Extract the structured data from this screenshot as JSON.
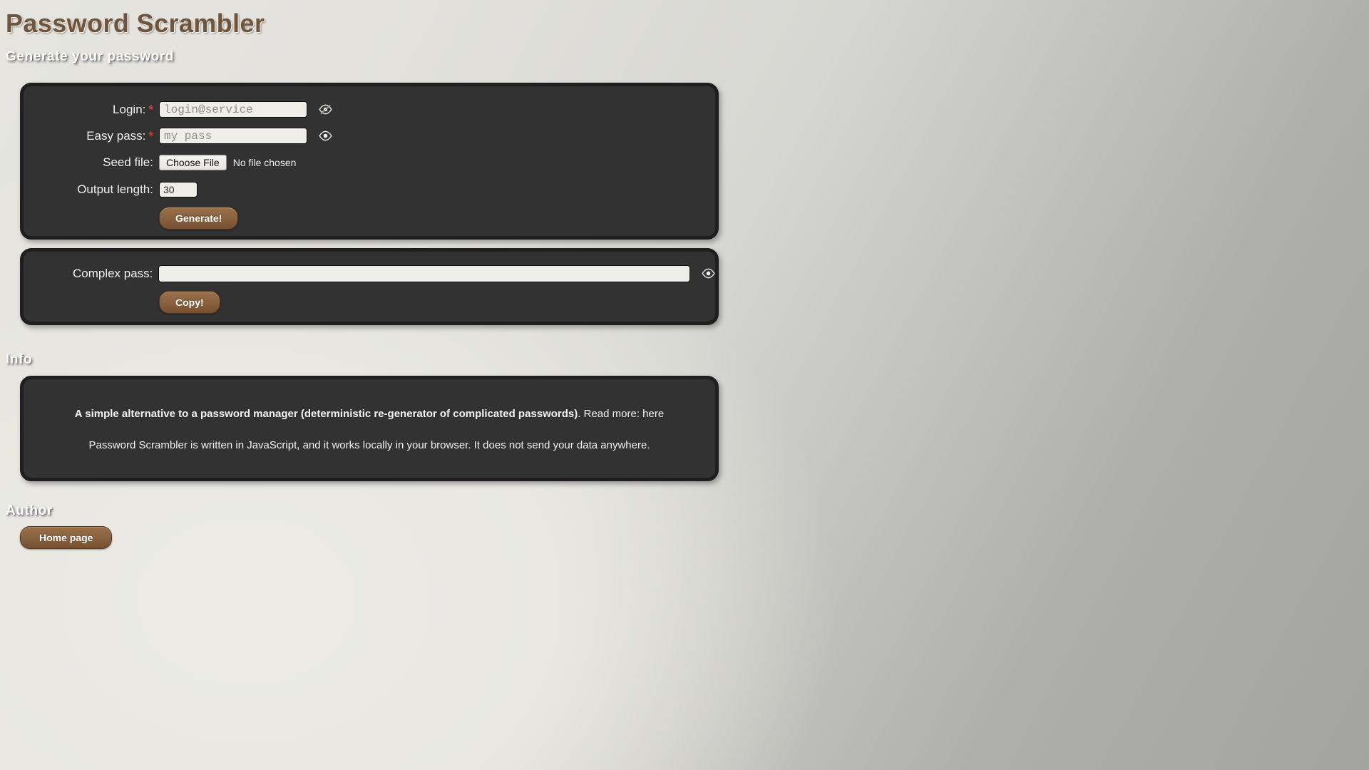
{
  "app": {
    "title": "Password Scrambler"
  },
  "generate_section": {
    "heading": "Generate your password",
    "fields": {
      "login": {
        "label": "Login:",
        "required_marker": "*",
        "value": "",
        "placeholder": "login@service",
        "toggle_icon": "eye-slash-icon"
      },
      "easy_pass": {
        "label": "Easy pass:",
        "required_marker": "*",
        "value": "",
        "placeholder": "my pass",
        "toggle_icon": "eye-icon"
      },
      "seed_file": {
        "label": "Seed file:",
        "button_label": "Choose File",
        "status": "No file chosen"
      },
      "output_length": {
        "label": "Output length:",
        "value": "30"
      }
    },
    "generate_button": "Generate!"
  },
  "result_section": {
    "complex_pass": {
      "label": "Complex pass:",
      "value": "",
      "placeholder": "",
      "toggle_icon": "eye-icon"
    },
    "copy_button": "Copy!"
  },
  "info_section": {
    "heading": "Info",
    "line1_bold": "A simple alternative to a password manager (deterministic re-generator of complicated passwords)",
    "line1_rest": ". Read more: ",
    "line1_link": "here",
    "line2": "Password Scrambler is written in JavaScript, and it works locally in your browser. It does not send your data anywhere."
  },
  "author_section": {
    "heading": "Author",
    "home_button": "Home page"
  },
  "colors": {
    "title_brown": "#6f553c",
    "button_brown": "#8a6340",
    "panel_bg": "#323232",
    "panel_border": "#1f1f1f",
    "required_red": "#e03a32",
    "input_bg": "#efede8"
  }
}
